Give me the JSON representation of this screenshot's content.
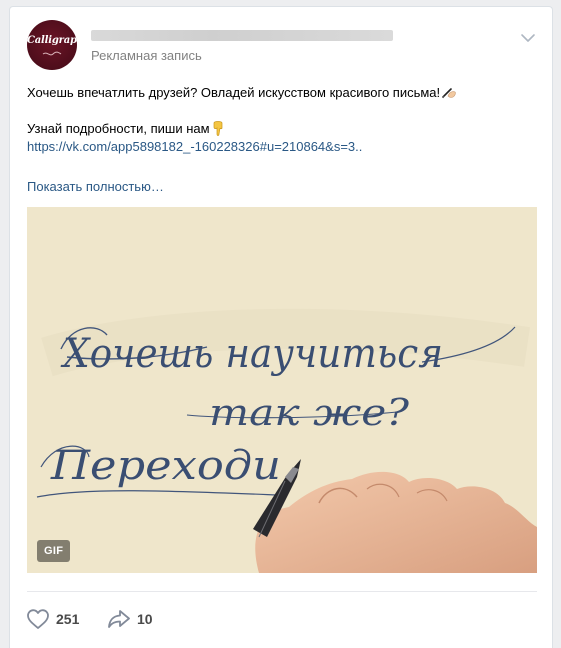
{
  "post": {
    "author_logo_text": "Calligraphy",
    "ad_label": "Рекламная запись",
    "text_line_1": "Хочешь впечатлить друзей? Овладей искусством красивого письма!",
    "text_line_2": "Узнай подробности, пиши нам",
    "link": "https://vk.com/app5898182_-160228326#u=210864&s=3..",
    "show_more": "Показать полностью…"
  },
  "media": {
    "type_badge": "GIF",
    "calligraphy_line_1": "Хочешь научиться",
    "calligraphy_line_2": "так же?",
    "calligraphy_line_3": "Переходи"
  },
  "actions": {
    "likes_count": "251",
    "shares_count": "10"
  },
  "icons": {
    "like": "heart-icon",
    "share": "share-arrow-icon",
    "menu": "chevron-down-icon",
    "writing_hand": "writing-hand-emoji-icon",
    "pointing_down": "point-down-emoji-icon"
  },
  "colors": {
    "link": "#2a5885",
    "avatar_bg": "#4e0d1b",
    "ink": "#3a4e72",
    "paper": "#efe6cb"
  }
}
